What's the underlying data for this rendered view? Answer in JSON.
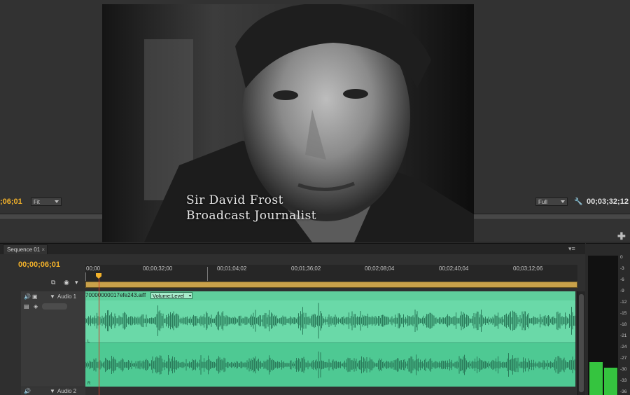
{
  "program_monitor": {
    "timecode_left": ";06;01",
    "zoom_select": "Fit",
    "resolution_select": "Full",
    "timecode_right": "00;03;32;12",
    "caption_name": "Sir David Frost",
    "caption_title": "Broadcast Journalist"
  },
  "timeline": {
    "tab_label": "Sequence 01",
    "current_timecode": "00;00;06;01",
    "ruler_labels": [
      "00;00",
      "00;00;32;00",
      "00;01;04;02",
      "00;01;36;02",
      "00;02;08;04",
      "00;02;40;04",
      "00;03;12;06"
    ],
    "tracks": [
      {
        "name": "Audio 1"
      },
      {
        "name": "Audio 2"
      }
    ],
    "clip": {
      "name": "70000000017efe243.aiff",
      "volume_dropdown": "Volume:Level",
      "channels": [
        "L",
        "R"
      ]
    }
  },
  "audio_meter": {
    "db_labels": [
      "0",
      "-3",
      "-6",
      "-9",
      "-12",
      "-15",
      "-18",
      "-21",
      "-24",
      "-27",
      "-30",
      "-33",
      "-36"
    ],
    "left_level_db": -27.5,
    "right_level_db": -29
  },
  "colors": {
    "timecode_accent": "#f2b12a",
    "clip_green": "#6ad9a8",
    "waveform": "#2a7a5a",
    "playhead": "#d23a2a",
    "meter_green": "#35c43f"
  }
}
